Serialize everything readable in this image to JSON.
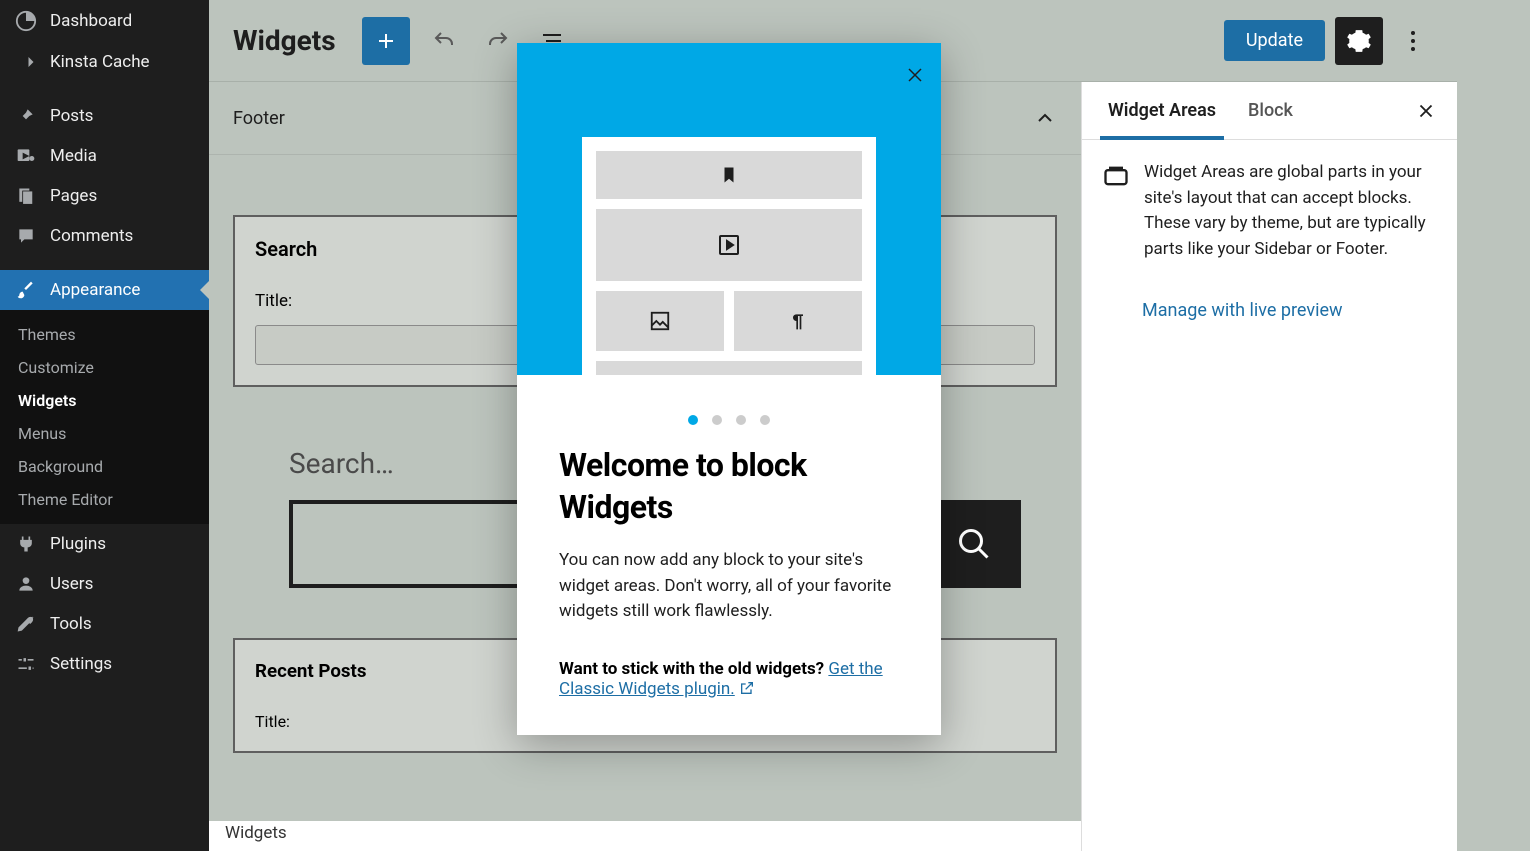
{
  "sidebar": {
    "items": [
      {
        "label": "Dashboard",
        "icon": "dashboard"
      },
      {
        "label": "Kinsta Cache",
        "icon": "kinsta"
      },
      {
        "label": "Posts",
        "icon": "pin"
      },
      {
        "label": "Media",
        "icon": "media"
      },
      {
        "label": "Pages",
        "icon": "pages"
      },
      {
        "label": "Comments",
        "icon": "comments"
      },
      {
        "label": "Appearance",
        "icon": "brush",
        "active": true
      },
      {
        "label": "Plugins",
        "icon": "plug"
      },
      {
        "label": "Users",
        "icon": "users"
      },
      {
        "label": "Tools",
        "icon": "tools"
      },
      {
        "label": "Settings",
        "icon": "settings"
      }
    ],
    "sub": [
      {
        "label": "Themes"
      },
      {
        "label": "Customize"
      },
      {
        "label": "Widgets",
        "active": true
      },
      {
        "label": "Menus"
      },
      {
        "label": "Background"
      },
      {
        "label": "Theme Editor"
      }
    ]
  },
  "topbar": {
    "title": "Widgets",
    "update": "Update"
  },
  "editor": {
    "area_label": "Footer",
    "search_widget": {
      "title": "Search",
      "field_label": "Title:"
    },
    "search_preview_label": "Search…",
    "recent_widget": {
      "title": "Recent Posts",
      "field_label": "Title:"
    },
    "breadcrumb": "Widgets"
  },
  "rightbar": {
    "tabs": [
      "Widget Areas",
      "Block"
    ],
    "description": "Widget Areas are global parts in your site's layout that can accept blocks. These vary by theme, but are typically parts like your Sidebar or Footer.",
    "link": "Manage with live preview"
  },
  "modal": {
    "title": "Welcome to block Widgets",
    "body": "You can now add any block to your site's widget areas. Don't worry, all of your favorite widgets still work flawlessly.",
    "foot_strong": "Want to stick with the old widgets?",
    "foot_link": "Get the Classic Widgets plugin."
  }
}
